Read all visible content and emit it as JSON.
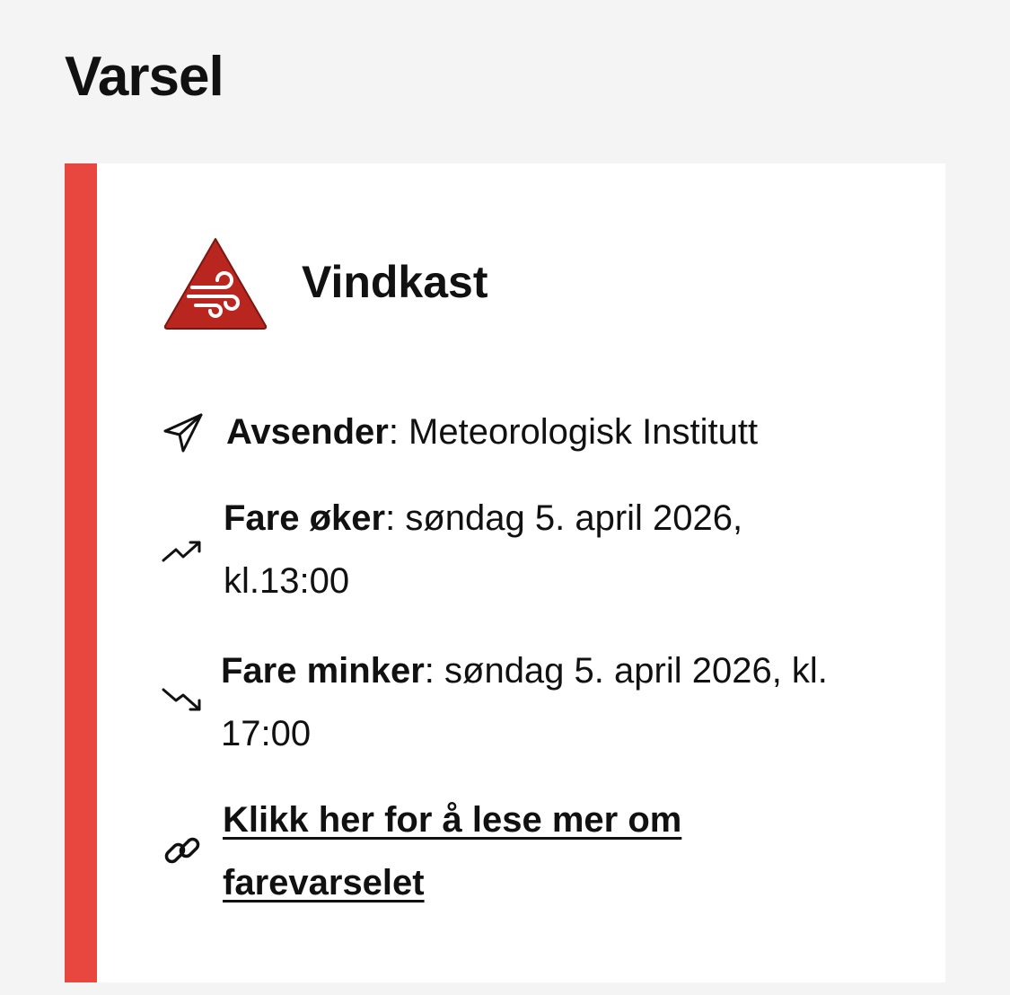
{
  "page": {
    "title": "Varsel"
  },
  "warning": {
    "title": "Vindkast",
    "icon": "wind-warning-icon",
    "level_color": "#b9261f",
    "accent_color": "#e8473f",
    "sender": {
      "label": "Avsender",
      "value": ": Meteorologisk Institutt",
      "icon": "send-icon"
    },
    "danger_increases": {
      "label": "Fare øker",
      "value": ": søndag 5. april 2026, kl.13:00",
      "icon": "trend-up-icon"
    },
    "danger_decreases": {
      "label": "Fare minker",
      "value": ": søndag 5. april 2026, kl. 17:00",
      "icon": "trend-down-icon"
    },
    "read_more": {
      "label": "Klikk her for å lese mer om farevarselet",
      "icon": "link-icon"
    }
  }
}
